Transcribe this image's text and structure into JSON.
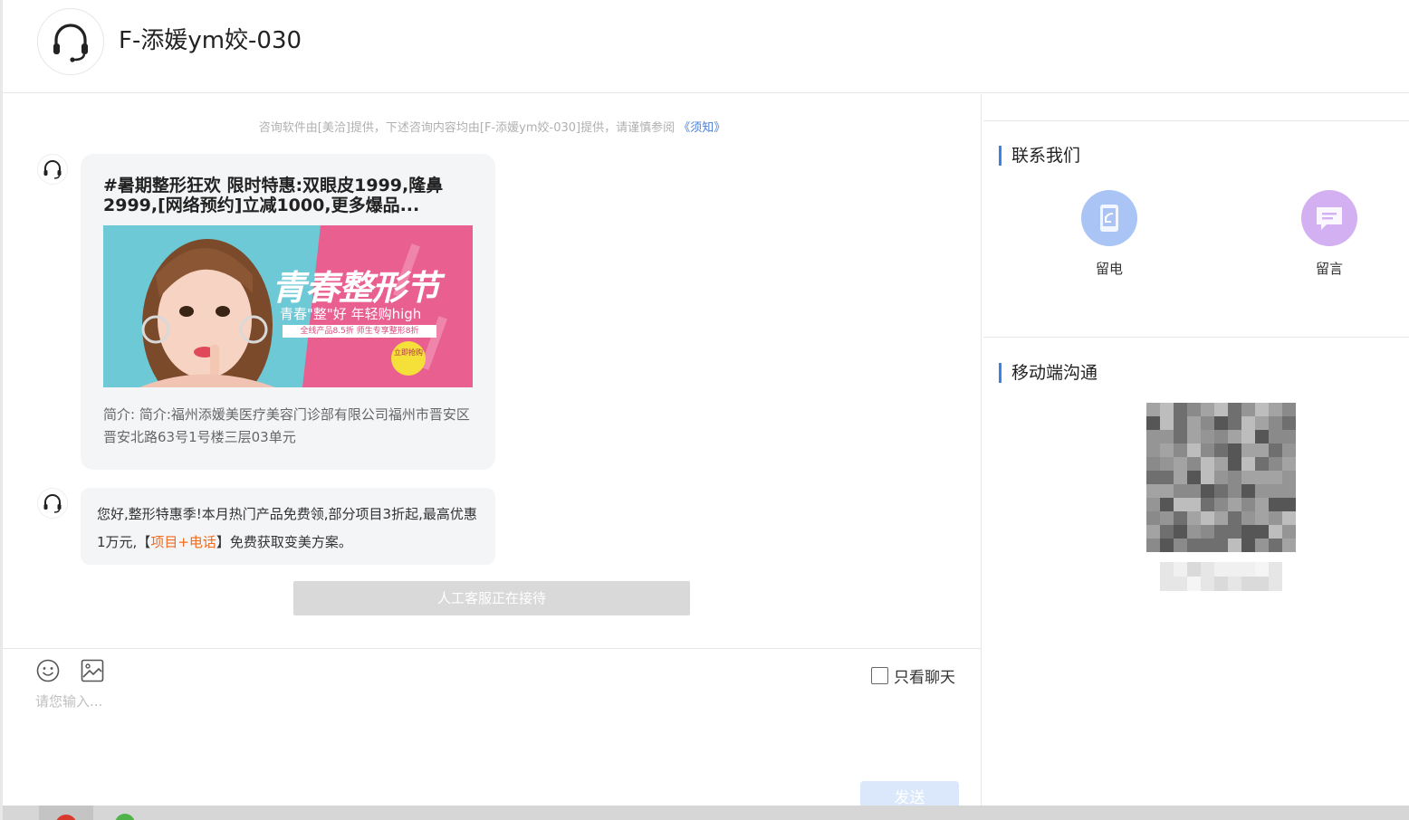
{
  "header": {
    "title": "F-添媛ym姣-030",
    "avatar_icon": "headset-icon"
  },
  "chat": {
    "notice_text": "咨询软件由[美洽]提供，下述咨询内容均由[F-添媛ym姣-030]提供，请谨慎参阅 ",
    "notice_link": "《须知》",
    "card": {
      "title": "#暑期整形狂欢 限时特惠:双眼皮1999,隆鼻2999,[网络预约]立减1000,更多爆品...",
      "banner": {
        "headline": "青春整形节",
        "subline": "青春\"整\"好  年轻购high",
        "strip": "全线产品8.5折    师生专享整形8折",
        "badge": "立即抢购"
      },
      "description": "简介: 简介:福州添媛美医疗美容门诊部有限公司福州市晋安区晋安北路63号1号楼三层03单元"
    },
    "message": {
      "part1": "您好,整形特惠季!本月热门产品免费领,部分项目3折起,最高优惠1万元,【",
      "highlight": "项目+电话",
      "part2": "】免费获取变美方案。"
    },
    "service_status": "人工客服正在接待"
  },
  "input": {
    "placeholder": "请您输入...",
    "only_chat_label": "只看聊天",
    "send_label": "发送",
    "tools": [
      "smile-icon",
      "image-icon"
    ]
  },
  "right_panel": {
    "contact_title": "联系我们",
    "contacts": [
      {
        "label": "留电",
        "color": "#a9c4f5",
        "icon": "phone-icon"
      },
      {
        "label": "留言",
        "color": "#d2b0f2",
        "icon": "message-icon"
      }
    ],
    "mobile_title": "移动端沟通"
  },
  "colors": {
    "accent": "#3b82e8",
    "highlight": "#f26b1d",
    "link": "#4a7fd4"
  }
}
